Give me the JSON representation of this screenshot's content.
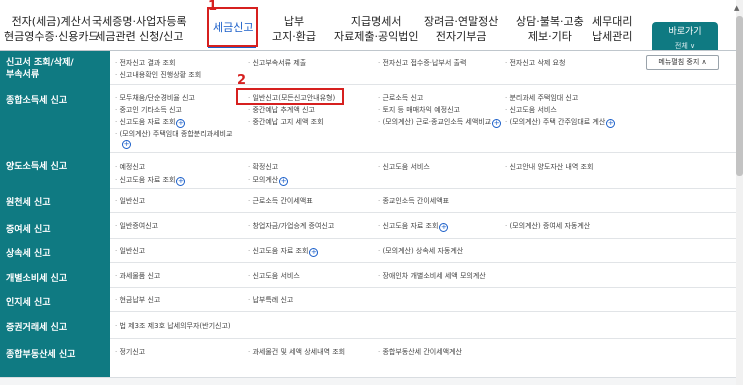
{
  "nav": {
    "items": [
      {
        "line1": "전자(세금)계산서",
        "line2": "현금영수증·신용카드"
      },
      {
        "line1": "국세증명·사업자등록",
        "line2": "세금관련 신청/신고"
      },
      {
        "line1": "세금신고",
        "line2": ""
      },
      {
        "line1": "납부",
        "line2": "고지·환급"
      },
      {
        "line1": "지급명세서",
        "line2": "자료제출·공익법인"
      },
      {
        "line1": "장려금·연말정산",
        "line2": "전자기부금"
      },
      {
        "line1": "상담·불복·고충",
        "line2": "제보·기타"
      },
      {
        "line1": "세무대리",
        "line2": "납세관리"
      }
    ],
    "shortcut_label": "바로가기",
    "shortcut_more": "전체 ∨",
    "scroll_up": "▲"
  },
  "callouts": {
    "one": "1",
    "two": "2"
  },
  "menu_stop_label": "메뉴펼침 중지 ∧",
  "categories": [
    {
      "line1": "신고서 조회/삭제/",
      "line2": "부속서류"
    },
    {
      "line1": "종합소득세 신고",
      "line2": ""
    },
    {
      "line1": "양도소득세 신고",
      "line2": ""
    },
    {
      "line1": "원천세 신고",
      "line2": ""
    },
    {
      "line1": "증여세 신고",
      "line2": ""
    },
    {
      "line1": "상속세 신고",
      "line2": ""
    },
    {
      "line1": "개별소비세 신고",
      "line2": ""
    },
    {
      "line1": "인지세 신고",
      "line2": ""
    },
    {
      "line1": "증권거래세 신고",
      "line2": ""
    },
    {
      "line1": "종합부동산세 신고",
      "line2": ""
    }
  ],
  "links": {
    "r1": [
      "전자신고 결과 조회",
      "신고부속서류 제출",
      "전자신고 접수증·납부서 출력",
      "전자신고 삭제 요청",
      "신고내용확인 진행상황 조회"
    ],
    "r2": [
      "모두채움/단순경비율 신고",
      "일반신고(모든신고안내유형)",
      "근로소득 신고",
      "분리과세 주택임대 신고",
      "중고인 기타소득 신고",
      "중간예납 추계액 신고",
      "토지 등 매매차익 예정신고",
      "신고도움 서비스",
      "신고도움 자료 조회",
      "중간예납 고지 세액 조회",
      "(모의계산) 근로·종교인소득 세액비교",
      "(모의계산) 주택 간주임대료 계산",
      "(모의계산) 주택임대 종합분리과세비교"
    ],
    "r3": [
      "예정신고",
      "확정신고",
      "신고도움 서비스",
      "신고안내 양도자산 내역 조회",
      "신고도움 자료 조회",
      "모의계산"
    ],
    "r4": [
      "일반신고",
      "근로소득 간이세액표",
      "종교인소득 간이세액표"
    ],
    "r5": [
      "일반증여신고",
      "창업자금/가업승계 증여신고",
      "신고도움 자료 조회",
      "(모의계산) 증여세 자동계산"
    ],
    "r6": [
      "일반신고",
      "신고도움 자료 조회",
      "(모의계산) 상속세 자동계산"
    ],
    "r7": [
      "과세물품 신고",
      "신고도움 서비스",
      "장애인차 개별소비세 세액 모의계산"
    ],
    "r8": [
      "현금납부 신고",
      "납부특례 신고"
    ],
    "r9": [
      "법 제3조 제3호 납세의무자(반기신고)"
    ],
    "r10": [
      "정기신고",
      "과세물건 및 세액 상세내역 조회",
      "종합부동산세 간이세액계산"
    ]
  }
}
